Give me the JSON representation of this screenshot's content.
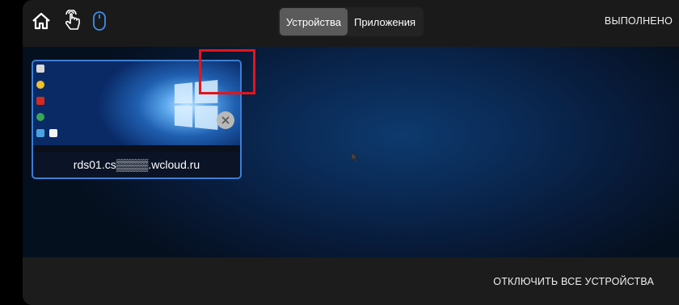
{
  "toolbar": {
    "icons": [
      "home-icon",
      "touch-gesture-icon",
      "mouse-icon"
    ],
    "tabs": [
      {
        "label": "Устройства",
        "active": true
      },
      {
        "label": "Приложения",
        "active": false
      }
    ],
    "done_label": "ВЫПОЛНЕНО"
  },
  "device": {
    "name": "rds01.cs▒▒▒▒.wcloud.ru",
    "close_icon": "close-icon"
  },
  "footer": {
    "disconnect_label": "ОТКЛЮЧИТЬ ВСЕ УСТРОЙСТВА"
  },
  "colors": {
    "accent": "#3d7fd4",
    "highlight": "#e4151b",
    "active_tab": "#5a5a5a"
  }
}
